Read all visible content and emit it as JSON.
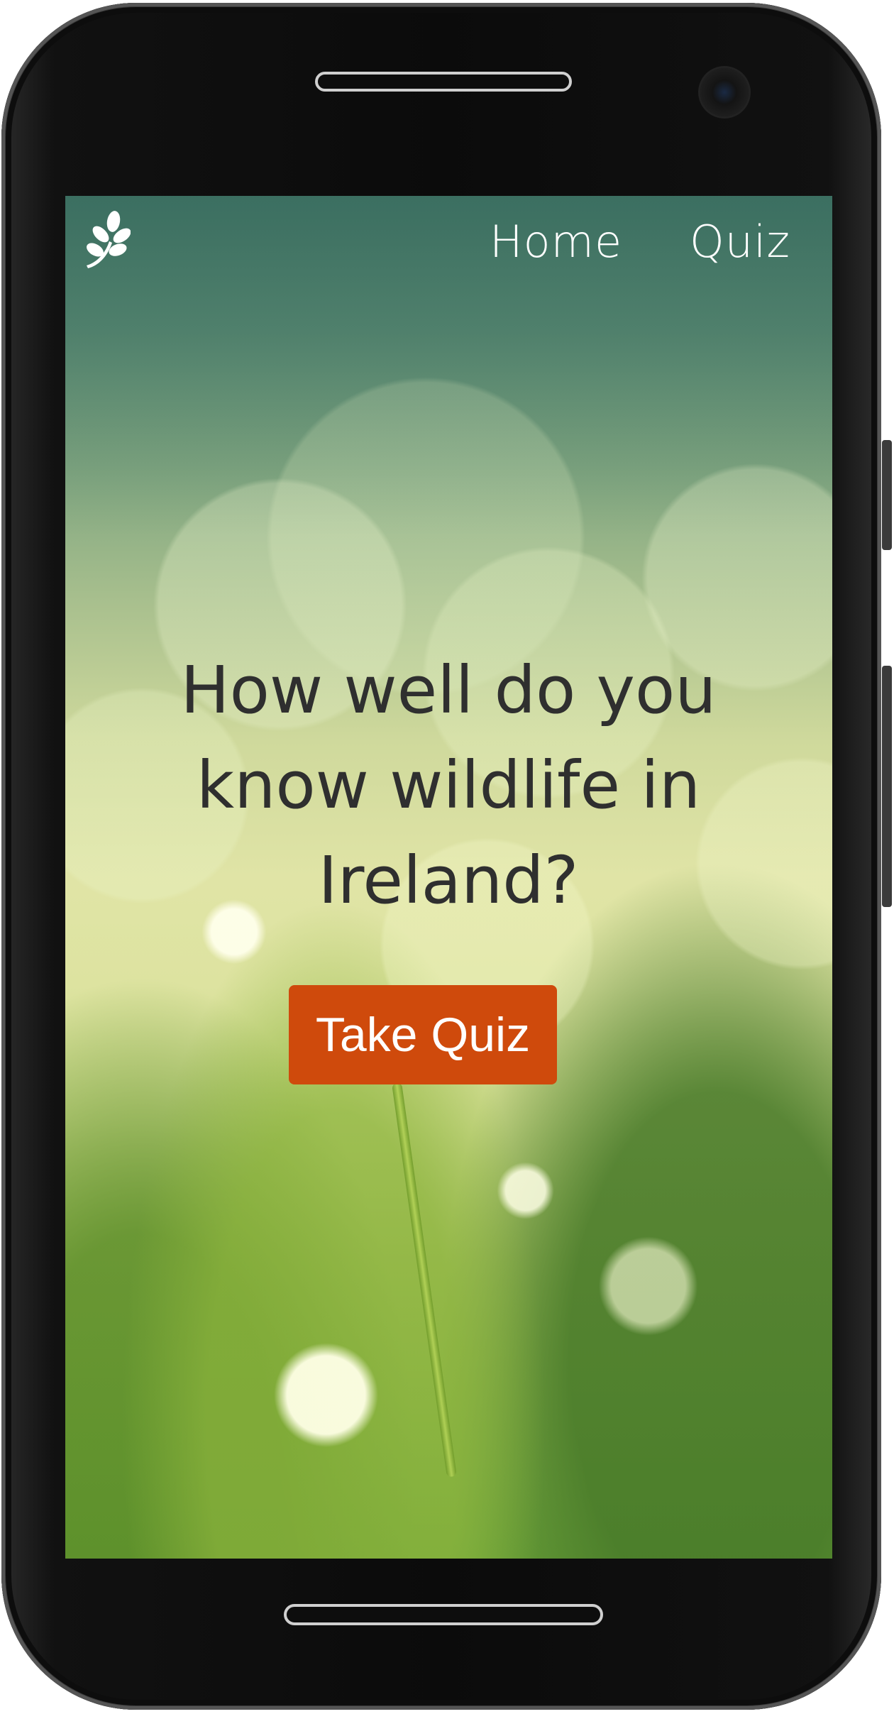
{
  "nav": {
    "logo_icon": "leaf-sprig-icon",
    "links": [
      {
        "label": "Home"
      },
      {
        "label": "Quiz"
      }
    ]
  },
  "hero": {
    "title": "How well do you know wildlife in Ireland?",
    "cta_label": "Take Quiz",
    "cta_color": "#cf4a0c"
  },
  "colors": {
    "title_text": "#2f2f2f",
    "nav_text": "#ffffff"
  }
}
